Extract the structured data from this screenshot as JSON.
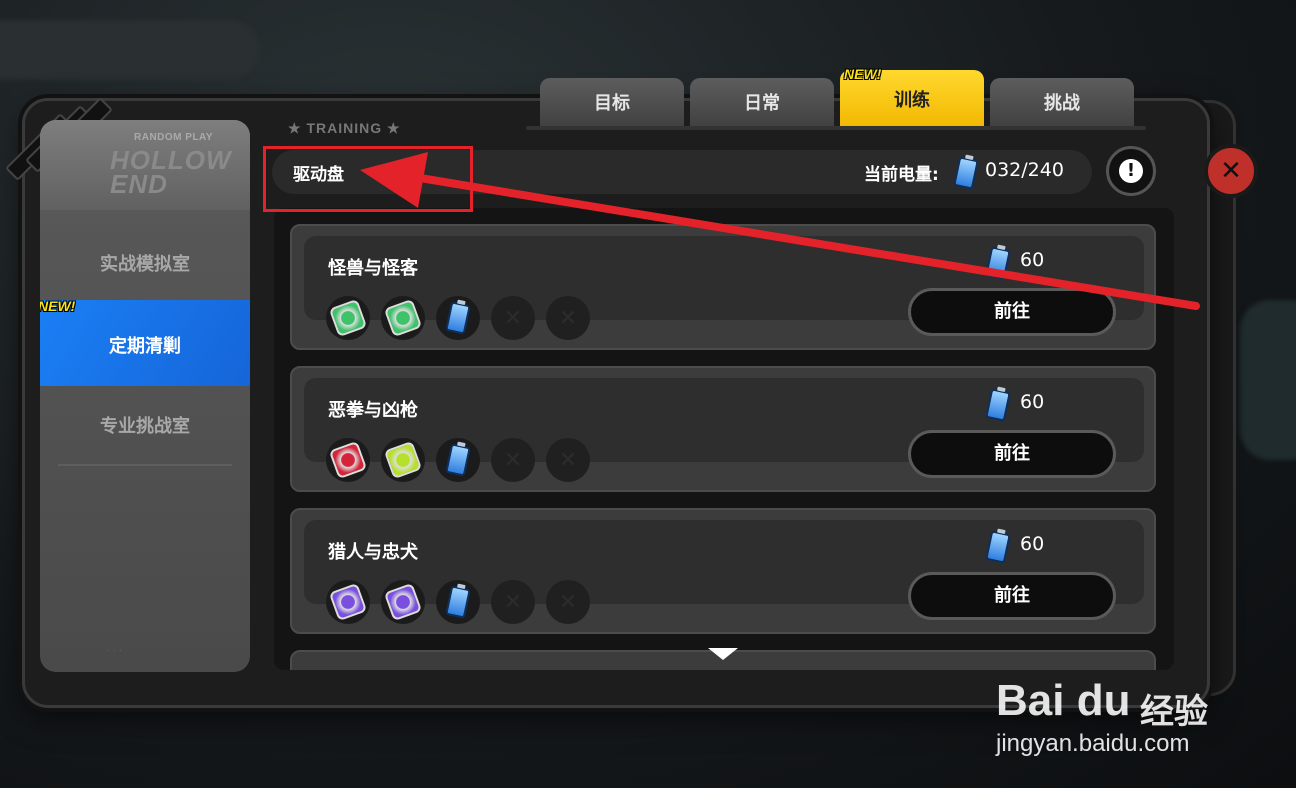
{
  "sidebar": {
    "logo_small": "RANDOM PLAY",
    "logo_big": "HOLLOW END",
    "items": [
      {
        "label": "实战模拟室",
        "active": false
      },
      {
        "label": "定期清剿",
        "active": true,
        "badge": "NEW!"
      },
      {
        "label": "专业挑战室",
        "active": false
      }
    ]
  },
  "tabs": [
    {
      "label": "目标",
      "active": false
    },
    {
      "label": "日常",
      "active": false
    },
    {
      "label": "训练",
      "active": true,
      "badge": "NEW!"
    },
    {
      "label": "挑战",
      "active": false
    }
  ],
  "section_label": "★ TRAINING ★",
  "header": {
    "title": "驱动盘",
    "energy_label": "当前电量:",
    "energy_value": "032/240"
  },
  "cards": [
    {
      "title": "怪兽与怪客",
      "cost": "60",
      "button": "前往",
      "rewards": [
        "green-disc",
        "green-disc",
        "battery",
        "empty",
        "empty"
      ]
    },
    {
      "title": "恶拳与凶枪",
      "cost": "60",
      "button": "前往",
      "rewards": [
        "red-disc",
        "yellow-green-disc",
        "battery",
        "empty",
        "empty"
      ]
    },
    {
      "title": "猎人与忠犬",
      "cost": "60",
      "button": "前往",
      "rewards": [
        "purple-disc",
        "purple-disc",
        "battery",
        "empty",
        "empty"
      ]
    }
  ],
  "watermark": {
    "brand": "Bai du",
    "cn": "经验",
    "url": "jingyan.baidu.com"
  },
  "colors": {
    "accent_yellow": "#ffd82e",
    "active_blue": "#1b7ff5",
    "annotation_red": "#e3222a",
    "close_red": "#c0302a"
  }
}
